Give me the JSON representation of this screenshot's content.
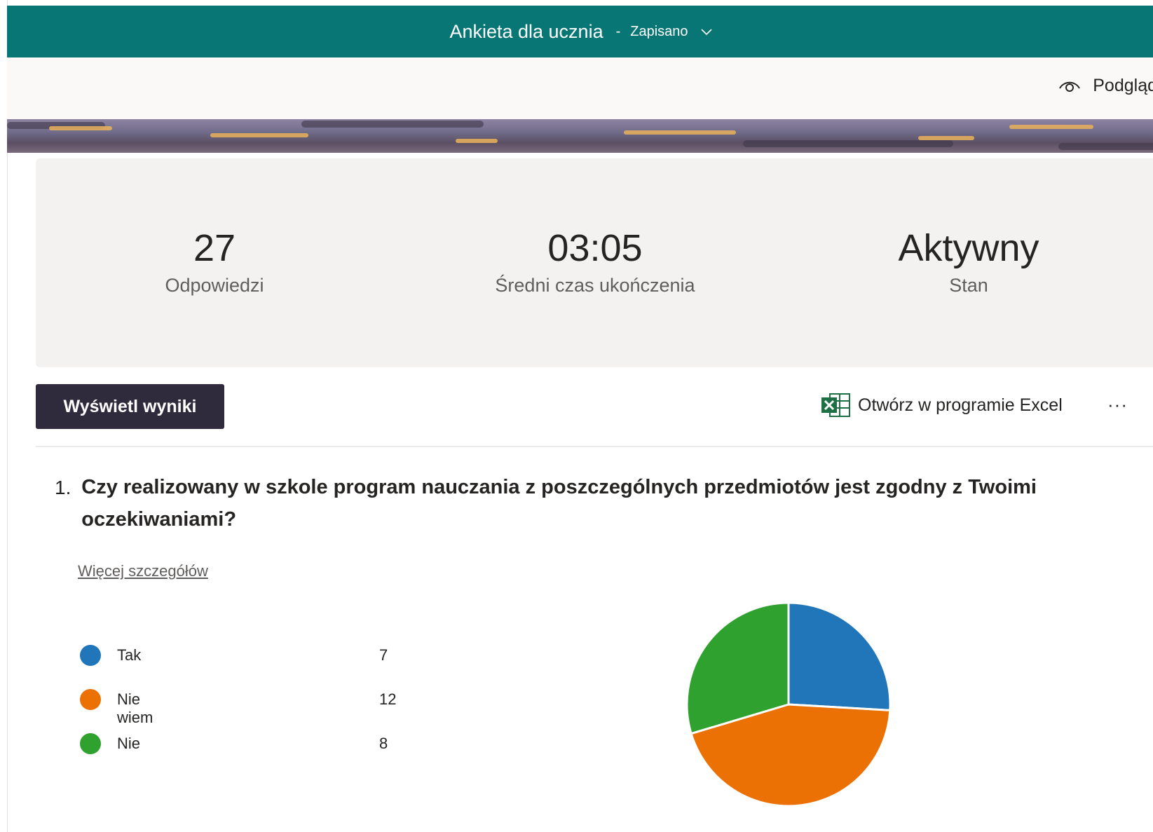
{
  "header": {
    "title": "Ankieta dla ucznia",
    "separator": "-",
    "status": "Zapisano",
    "bg_color": "#077675"
  },
  "toolbar": {
    "preview_label": "Podgląd",
    "preview_icon": "eye-icon"
  },
  "summary": {
    "responses": {
      "value": "27",
      "label": "Odpowiedzi"
    },
    "avg_time": {
      "value": "03:05",
      "label": "Średni czas ukończenia"
    },
    "status": {
      "value": "Aktywny",
      "label": "Stan"
    }
  },
  "actions": {
    "view_results": "Wyświetl wyniki",
    "open_excel": "Otwórz w programie Excel",
    "excel_icon": "excel-icon",
    "more": "···"
  },
  "question": {
    "number": "1.",
    "text": "Czy realizowany w szkole program nauczania z poszczególnych przedmiotów jest zgodny z Twoimi oczekiwaniami?",
    "details_link": "Więcej szczegółów"
  },
  "chart_data": {
    "type": "pie",
    "categories": [
      "Tak",
      "Nie wiem",
      "Nie"
    ],
    "values": [
      7,
      12,
      8
    ],
    "colors": [
      "#2175b9",
      "#ec7105",
      "#2ea12e"
    ]
  }
}
